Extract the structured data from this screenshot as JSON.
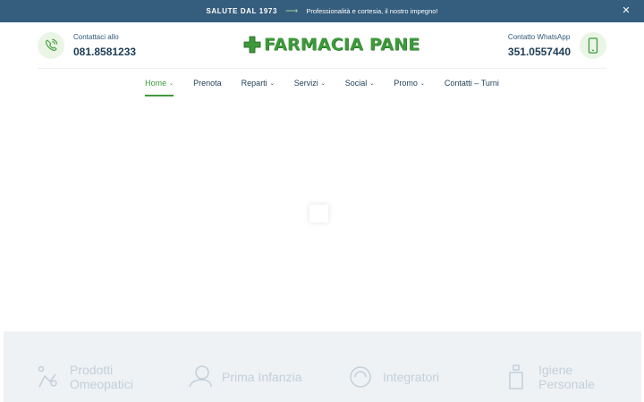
{
  "topbar": {
    "badge": "SALUTE DAL 1973",
    "message": "Professionalità e cortesia, il nostro impegno!"
  },
  "header": {
    "left_contact": {
      "label": "Contattaci allo",
      "number": "081.8581233",
      "icon": "phone-ringing-icon"
    },
    "right_contact": {
      "label": "Contatto WhatsApp",
      "number": "351.0557440",
      "icon": "smartphone-icon"
    },
    "logo": {
      "text": "FARMACIA PANE",
      "icon": "green-cross-icon"
    }
  },
  "nav": {
    "items": [
      {
        "label": "Home",
        "active": true,
        "dropdown": true
      },
      {
        "label": "Prenota",
        "active": false,
        "dropdown": false
      },
      {
        "label": "Reparti",
        "active": false,
        "dropdown": true
      },
      {
        "label": "Servizi",
        "active": false,
        "dropdown": true
      },
      {
        "label": "Social",
        "active": false,
        "dropdown": true
      },
      {
        "label": "Promo",
        "active": false,
        "dropdown": true
      },
      {
        "label": "Contatti – Turni",
        "active": false,
        "dropdown": false
      }
    ]
  },
  "services": [
    {
      "label": "Prodotti Omeopatici",
      "icon": "homeopathy-icon"
    },
    {
      "label": "Prima Infanzia",
      "icon": "baby-icon"
    },
    {
      "label": "Integratori",
      "icon": "supplement-icon"
    },
    {
      "label": "Igiene Personale",
      "icon": "hygiene-icon"
    }
  ],
  "colors": {
    "topbar": "#355d7d",
    "accent": "#3d9a3a",
    "text": "#1d3c55",
    "icon_bg": "#eaf5e6"
  }
}
